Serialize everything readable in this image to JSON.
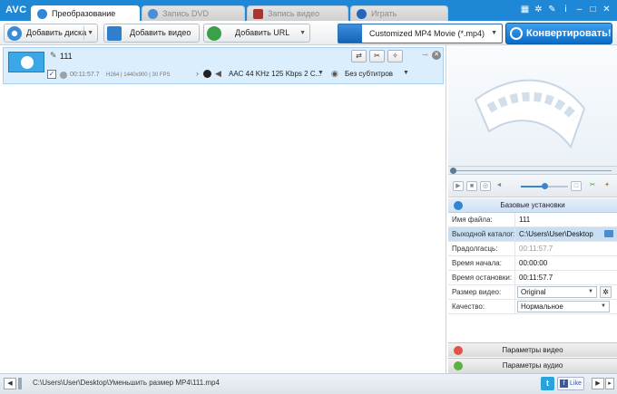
{
  "app": {
    "logo": "AVC"
  },
  "tabs": [
    {
      "label": "Преобразование",
      "active": true
    },
    {
      "label": "Запись DVD",
      "active": false
    },
    {
      "label": "Запись видео",
      "active": false
    },
    {
      "label": "Играть",
      "active": false
    }
  ],
  "title_icons": [
    "film-icon",
    "gear-icon",
    "wrench-icon",
    "info-icon",
    "minimize-icon",
    "maximize-icon",
    "close-icon"
  ],
  "toolbar": {
    "add_disc": "Добавить диска",
    "add_video": "Добавить видео",
    "add_url": "Добавить URL",
    "profile": "Customized MP4 Movie (*.mp4)",
    "convert": "Конвертировать!"
  },
  "file": {
    "name": "111",
    "duration": "00:11:57.7",
    "video_info": "H264 | 1440x900 | 30 FPS",
    "audio": "AAC 44 KHz 125 Kbps 2 C...",
    "subtitles": "Без субтитров"
  },
  "settings": {
    "header": "Базовые установки",
    "rows": {
      "filename": {
        "label": "Имя файла:",
        "value": "111"
      },
      "output": {
        "label": "Выходной каталог:",
        "value": "C:\\Users\\User\\Desktop"
      },
      "duration": {
        "label": "Прадолгасць:",
        "value": "00:11:57.7"
      },
      "start": {
        "label": "Время начала:",
        "value": "00:00:00"
      },
      "stop": {
        "label": "Время остановки:",
        "value": "00:11:57.7"
      },
      "size": {
        "label": "Размер видео:",
        "value": "Original"
      },
      "quality": {
        "label": "Качество:",
        "value": "Нормальное"
      }
    },
    "video_params": "Параметры видео",
    "audio_params": "Параметры аудио"
  },
  "status": {
    "path": "C:\\Users\\User\\Desktop\\Уменьшить размер MP4\\111.mp4",
    "twitter": "t",
    "like": "Like"
  },
  "colors": {
    "accent": "#1e88d6",
    "selection": "#dbeefd",
    "convert": "#0b6cc7"
  }
}
